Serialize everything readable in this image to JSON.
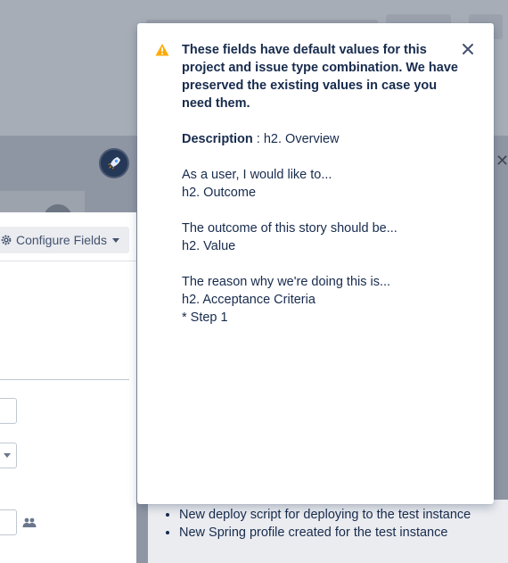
{
  "flag": {
    "title": "These fields have default values for this project and issue type combination. We have preserved the existing values in case you need them.",
    "description_label": "Description",
    "description_sep": " : ",
    "description_value": "h2. Overview\n\nAs a user, I would like to...\nh2. Outcome\n\nThe outcome of this story should be...\nh2. Value\n\nThe reason why we're doing this is...\nh2. Acceptance Criteria\n * Step 1",
    "icons": {
      "warning": "warning-icon",
      "close": "close-icon"
    },
    "warning_color": "#ffab00"
  },
  "form": {
    "configure_fields_label": "Configure Fields"
  },
  "background_description": {
    "items": [
      "New deploy script for deploying to the test instance",
      "New Spring profile created for the test instance"
    ]
  },
  "colors": {
    "text": "#172b4d",
    "overlay": "#8f96a3"
  }
}
